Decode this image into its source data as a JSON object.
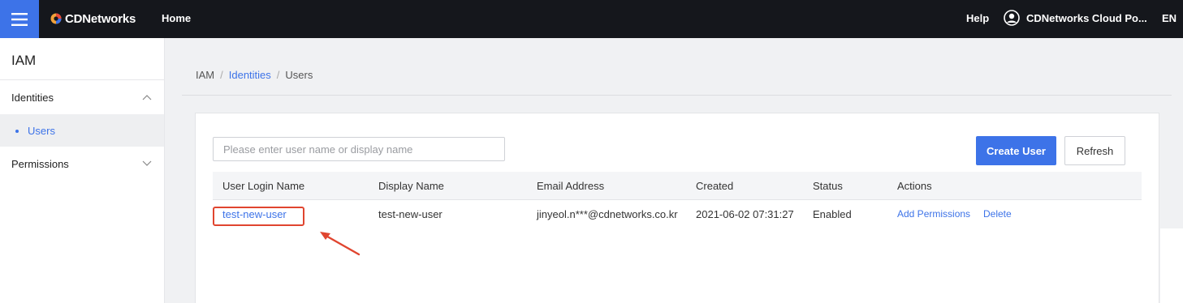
{
  "topbar": {
    "brand": "CDNetworks",
    "nav_home": "Home",
    "help": "Help",
    "user_name": "CDNetworks Cloud Po...",
    "language": "EN",
    "icons": {
      "menu": "hamburger-menu-icon",
      "user": "user-circle-icon",
      "logo": "cdnetworks-logo-icon"
    },
    "accent_color": "#3d73e8",
    "bar_color": "#15171c"
  },
  "sidebar": {
    "title": "IAM",
    "groups": [
      {
        "label": "Identities",
        "expanded": true,
        "items": [
          {
            "label": "Users",
            "active": true
          }
        ]
      },
      {
        "label": "Permissions",
        "expanded": false,
        "items": []
      }
    ]
  },
  "breadcrumb": {
    "root": "IAM",
    "parent": "Identities",
    "current": "Users"
  },
  "toolbar": {
    "search_placeholder": "Please enter user name or display name",
    "search_value": "",
    "create_label": "Create User",
    "refresh_label": "Refresh"
  },
  "table": {
    "columns": [
      "User Login Name",
      "Display Name",
      "Email Address",
      "Created",
      "Status",
      "Actions"
    ],
    "rows": [
      {
        "login_name": "test-new-user",
        "display_name": "test-new-user",
        "email": "jinyeol.n***@cdnetworks.co.kr",
        "created": "2021-06-02 07:31:27",
        "status": "Enabled",
        "actions": [
          "Add Permissions",
          "Delete"
        ]
      }
    ]
  },
  "annotation": {
    "highlight_color": "#e0452f"
  }
}
